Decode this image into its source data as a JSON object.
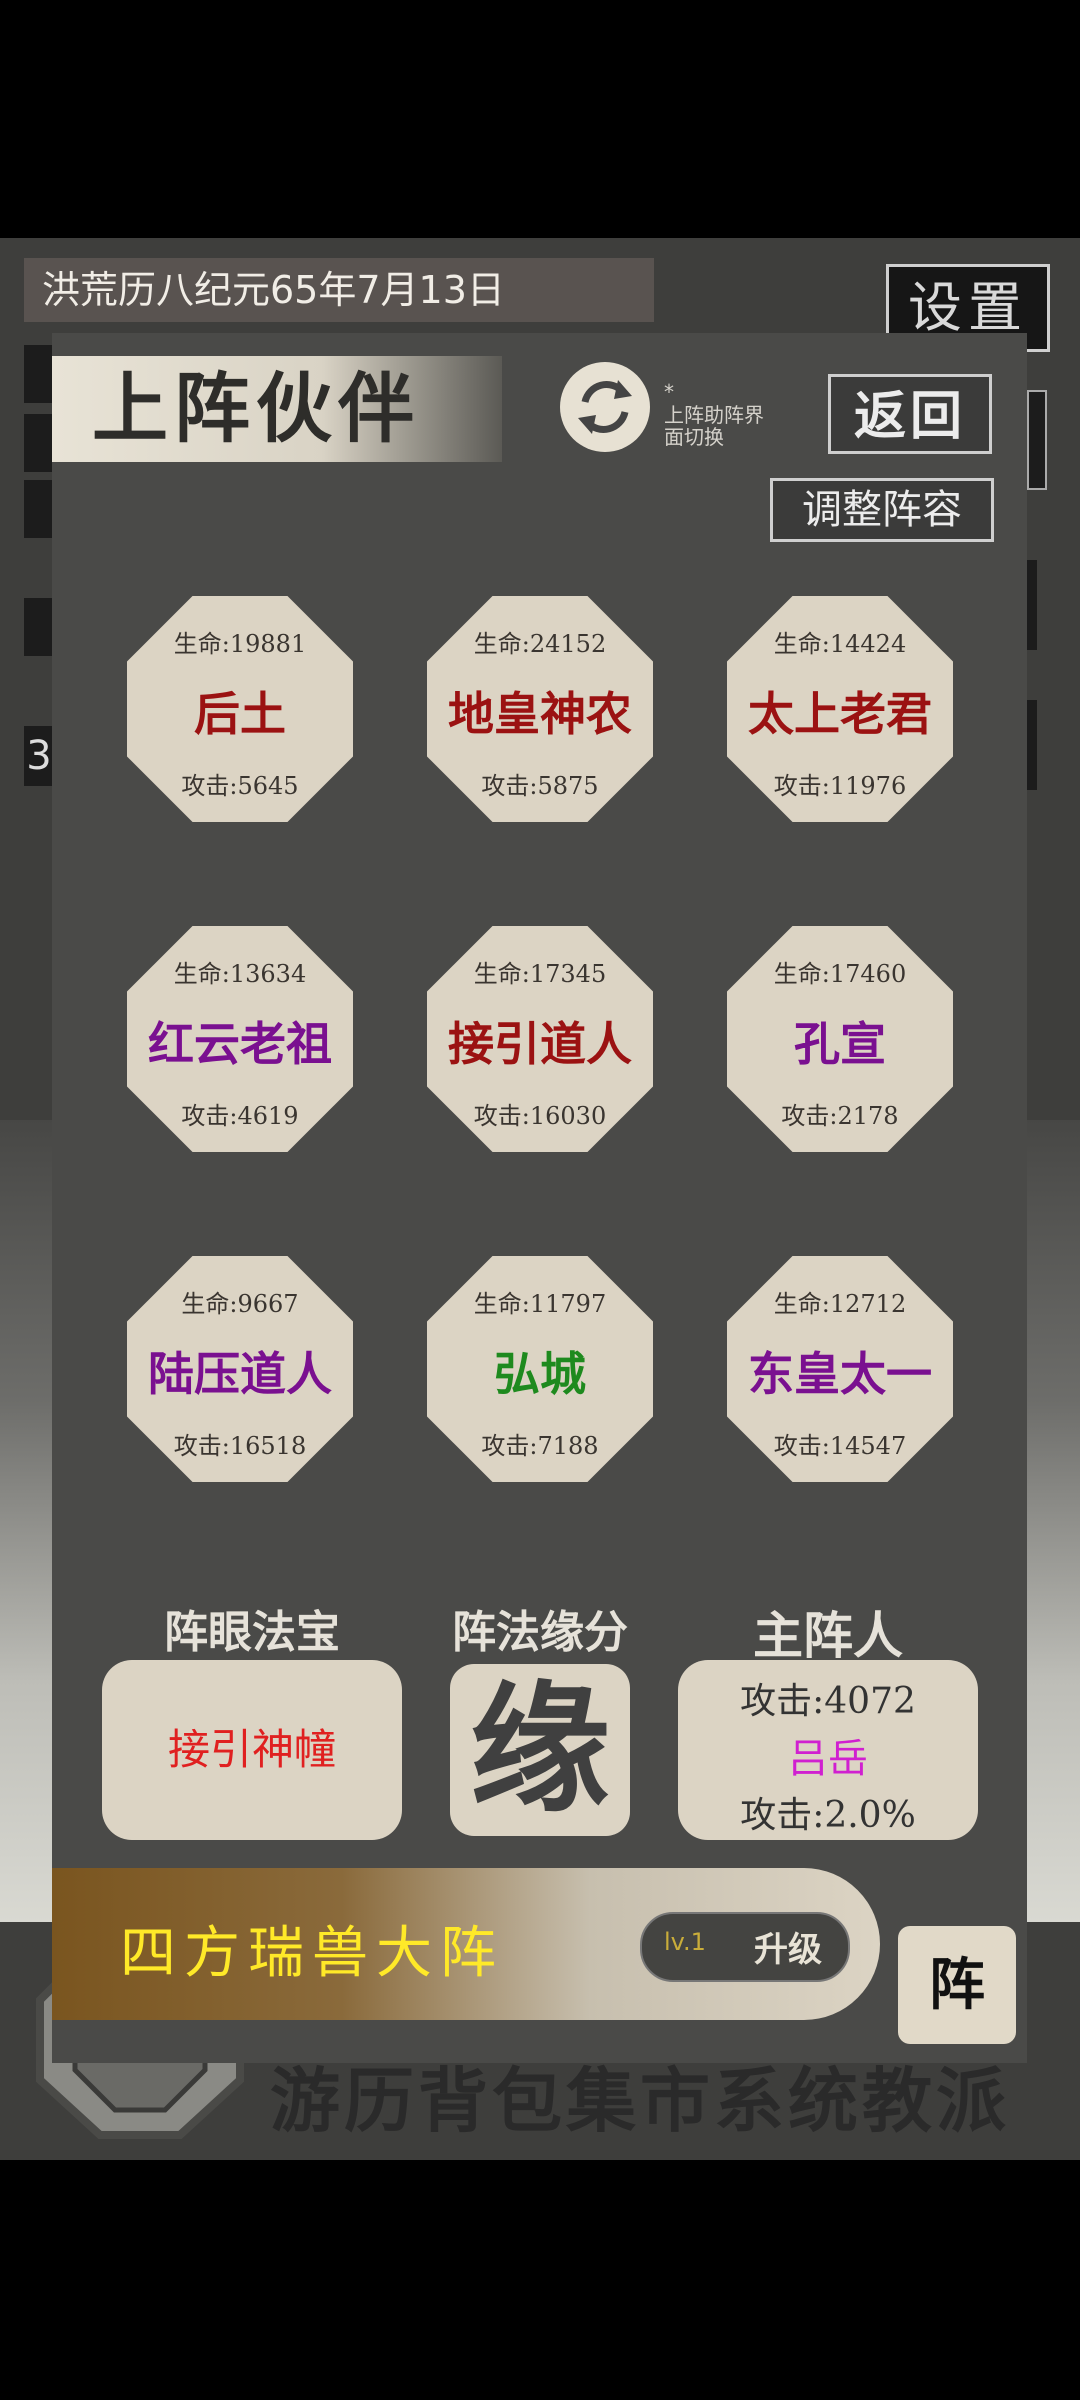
{
  "background": {
    "date": "洪荒历八纪元65年7月13日",
    "settings_label": "设置",
    "side_digit": "3",
    "bottom_nav": "游历背包集市系统教派"
  },
  "modal": {
    "title": "上阵伙伴",
    "swap_note_mark": "*",
    "swap_note": "上阵助阵界面切换",
    "return_label": "返回",
    "adjust_label": "调整阵容",
    "partners": [
      {
        "hp": "生命:19881",
        "name": "后土",
        "atk": "攻击:5645",
        "color": "#9b1212"
      },
      {
        "hp": "生命:24152",
        "name": "地皇神农",
        "atk": "攻击:5875",
        "color": "#9b1212"
      },
      {
        "hp": "生命:14424",
        "name": "太上老君",
        "atk": "攻击:11976",
        "color": "#9b1212"
      },
      {
        "hp": "生命:13634",
        "name": "红云老祖",
        "atk": "攻击:4619",
        "color": "#7a1090"
      },
      {
        "hp": "生命:17345",
        "name": "接引道人",
        "atk": "攻击:16030",
        "color": "#9b1212"
      },
      {
        "hp": "生命:17460",
        "name": "孔宣",
        "atk": "攻击:2178",
        "color": "#7a1090"
      },
      {
        "hp": "生命:9667",
        "name": "陆压道人",
        "atk": "攻击:16518",
        "color": "#7a1090"
      },
      {
        "hp": "生命:11797",
        "name": "弘城",
        "atk": "攻击:7188",
        "color": "#1e8a1e"
      },
      {
        "hp": "生命:12712",
        "name": "东皇太一",
        "atk": "攻击:14547",
        "color": "#7a1090"
      }
    ],
    "treasure": {
      "label": "阵眼法宝",
      "value": "接引神幢"
    },
    "fate": {
      "label": "阵法缘分",
      "glyph": "缘"
    },
    "leader": {
      "label": "主阵人",
      "atk": "攻击:4072",
      "name": "吕岳",
      "bonus": "攻击:2.0%"
    },
    "formation": {
      "name": "四方瑞兽大阵",
      "level": "lv.1",
      "upgrade_label": "升级",
      "zhen_label": "阵"
    }
  },
  "icons": {
    "swap": "refresh-arrows-icon",
    "emblem": "octagon-emblem-icon"
  },
  "colors": {
    "modal_bg": "#4a4a48",
    "card_bg": "#dcd4c4",
    "formation_text": "#ffe928",
    "leader_name": "#d020d0",
    "treasure_text": "#e02020"
  }
}
